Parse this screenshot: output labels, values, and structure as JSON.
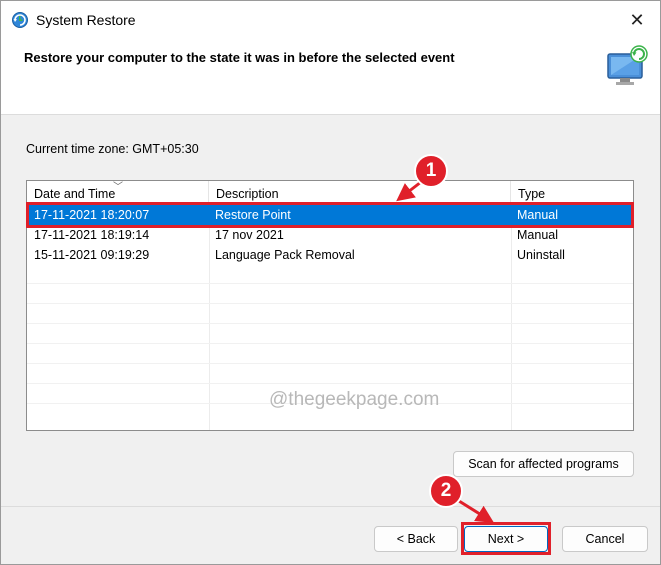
{
  "window": {
    "title": "System Restore",
    "header_title": "Restore your computer to the state it was in before the selected event",
    "close_glyph": "✕"
  },
  "timezone_label": "Current time zone: GMT+05:30",
  "table": {
    "columns": [
      "Date and Time",
      "Description",
      "Type"
    ],
    "rows": [
      {
        "date": "17-11-2021 18:20:07",
        "description": "Restore Point",
        "type": "Manual",
        "selected": true
      },
      {
        "date": "17-11-2021 18:19:14",
        "description": "17 nov 2021",
        "type": "Manual",
        "selected": false
      },
      {
        "date": "15-11-2021 09:19:29",
        "description": "Language Pack Removal",
        "type": "Uninstall",
        "selected": false
      }
    ]
  },
  "watermark": "@thegeekpage.com",
  "buttons": {
    "scan": "Scan for affected programs",
    "back": "< Back",
    "next": "Next >",
    "cancel": "Cancel"
  },
  "annotations": {
    "step1": "1",
    "step2": "2"
  },
  "colors": {
    "selection": "#0078d7",
    "annotation_red": "#e0202a"
  },
  "icons": {
    "title": "system-restore-icon",
    "header": "restore-monitor-icon"
  }
}
